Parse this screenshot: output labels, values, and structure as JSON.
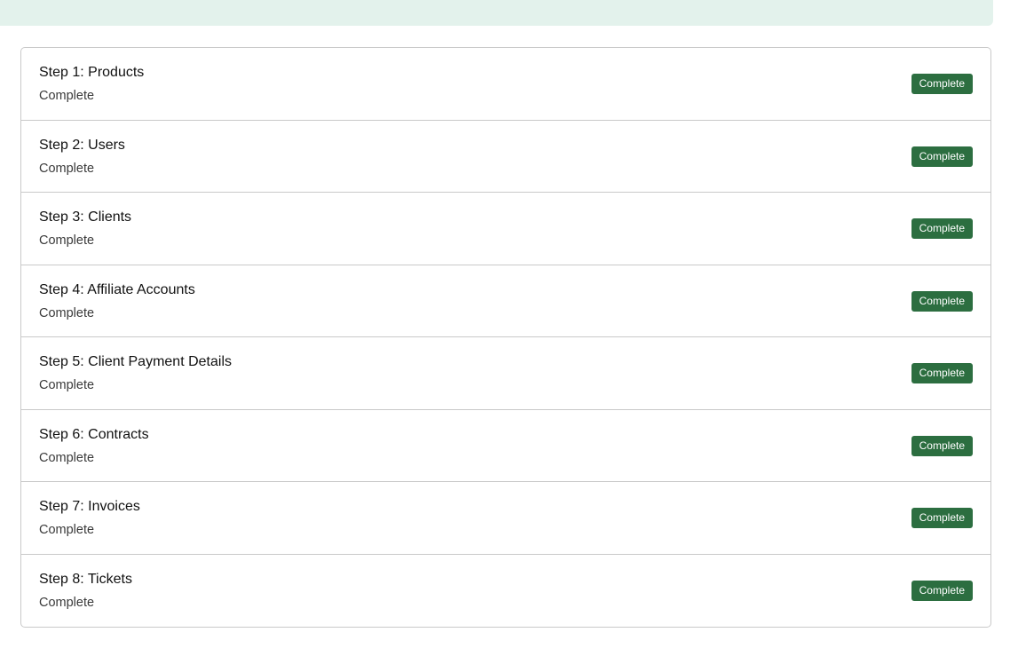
{
  "colors": {
    "banner_bg": "#e3f2ec",
    "badge_bg": "#2c6e40",
    "badge_text": "#ffffff",
    "border": "#c9c9c9"
  },
  "steps": [
    {
      "title": "Step 1: Products",
      "status": "Complete",
      "badge": "Complete"
    },
    {
      "title": "Step 2: Users",
      "status": "Complete",
      "badge": "Complete"
    },
    {
      "title": "Step 3: Clients",
      "status": "Complete",
      "badge": "Complete"
    },
    {
      "title": "Step 4: Affiliate Accounts",
      "status": "Complete",
      "badge": "Complete"
    },
    {
      "title": "Step 5: Client Payment Details",
      "status": "Complete",
      "badge": "Complete"
    },
    {
      "title": "Step 6: Contracts",
      "status": "Complete",
      "badge": "Complete"
    },
    {
      "title": "Step 7: Invoices",
      "status": "Complete",
      "badge": "Complete"
    },
    {
      "title": "Step 8: Tickets",
      "status": "Complete",
      "badge": "Complete"
    }
  ]
}
